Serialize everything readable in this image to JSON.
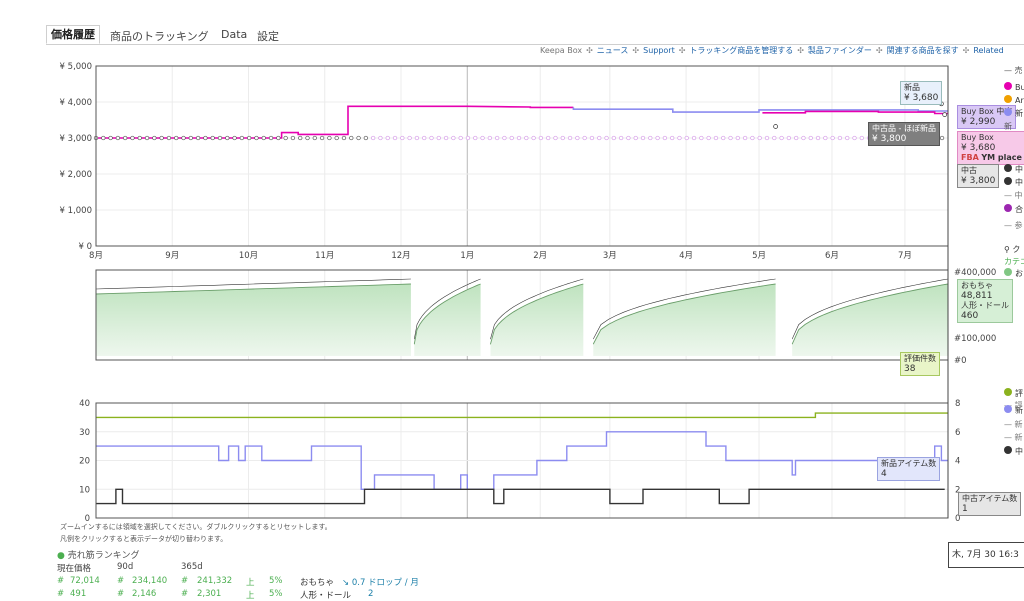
{
  "tabs": [
    "価格履歴",
    "商品のトラッキング",
    "Data",
    "設定"
  ],
  "links": [
    {
      "label": "Keepa Box",
      "gray": true
    },
    {
      "label": "ニュース"
    },
    {
      "label": "Support"
    },
    {
      "label": "トラッキング商品を管理する"
    },
    {
      "label": "製品ファインダー"
    },
    {
      "label": "関連する商品を探す"
    },
    {
      "label": "Related"
    }
  ],
  "chart_data": [
    {
      "type": "line",
      "name": "price-chart",
      "x": [
        "8月",
        "9月",
        "10月",
        "11月",
        "12月",
        "1月",
        "2月",
        "3月",
        "4月",
        "5月",
        "6月",
        "7月"
      ],
      "y_ticks": [
        "¥ 0",
        "¥ 1,000",
        "¥ 2,000",
        "¥ 3,000",
        "¥ 4,000",
        "¥ 5,000"
      ],
      "ylim": [
        0,
        5000
      ],
      "series": [
        {
          "legend_mark": "pink",
          "color": "#e600b0",
          "points": [
            [
              0,
              3000
            ],
            [
              5.6,
              3000
            ],
            [
              5.6,
              3150
            ],
            [
              6.1,
              3150
            ],
            [
              6.1,
              3100
            ],
            [
              7.6,
              3100
            ],
            [
              7.6,
              3880
            ],
            [
              11.2,
              3880
            ],
            [
              12.2,
              3870
            ],
            [
              13.1,
              3860
            ],
            [
              13.1,
              3850
            ],
            [
              14.4,
              3850
            ]
          ]
        },
        {
          "legend_mark": "blue",
          "color": "#8c8cf0",
          "points": [
            [
              14.4,
              3850
            ],
            [
              14.4,
              3800
            ],
            [
              17.4,
              3800
            ],
            [
              17.4,
              3720
            ],
            [
              20.0,
              3720
            ],
            [
              20.0,
              3780
            ],
            [
              24.8,
              3780
            ],
            [
              24.8,
              3750
            ],
            [
              25.7,
              3750
            ]
          ]
        },
        {
          "legend_mark": "pink-2",
          "color": "#e600b0",
          "points": [
            [
              20.1,
              3700
            ],
            [
              21.4,
              3700
            ],
            [
              21.4,
              3740
            ],
            [
              23.6,
              3740
            ],
            [
              23.6,
              3720
            ],
            [
              25.3,
              3720
            ],
            [
              25.3,
              3680
            ],
            [
              25.7,
              3680
            ]
          ]
        },
        {
          "legend_mark": "dots",
          "color": "#333",
          "value": 3000
        }
      ]
    },
    {
      "type": "area",
      "name": "sales-rank-chart",
      "y_ticks": [
        "#400,000",
        "#100,000",
        "#0"
      ],
      "series": [
        {
          "legend_mark": "rank",
          "color": "#4caf50"
        }
      ]
    },
    {
      "type": "line",
      "name": "count-chart",
      "y_ticks_left": [
        "0",
        "10",
        "20",
        "30",
        "40"
      ],
      "y_ticks_right": [
        "0",
        "2",
        "4",
        "6",
        "8"
      ],
      "ylim_left": [
        0,
        40
      ],
      "ylim_right": [
        0,
        8
      ],
      "series": [
        {
          "legend_mark": "review-count",
          "color": "#8bb21e",
          "axis": "right",
          "points": [
            [
              0,
              7
            ],
            [
              21.7,
              7
            ],
            [
              21.7,
              7.3
            ],
            [
              25.7,
              7.3
            ]
          ]
        },
        {
          "legend_mark": "new-offers",
          "color": "#8c8cf0",
          "axis": "right",
          "points": [
            [
              0,
              5
            ],
            [
              3.7,
              5
            ],
            [
              3.7,
              4
            ],
            [
              4.0,
              4
            ],
            [
              4.0,
              5
            ],
            [
              4.3,
              5
            ],
            [
              4.3,
              4
            ],
            [
              4.5,
              4
            ],
            [
              4.5,
              5
            ],
            [
              5.0,
              5
            ],
            [
              5.0,
              4
            ],
            [
              6.5,
              4
            ],
            [
              6.5,
              5
            ],
            [
              8.0,
              5
            ],
            [
              8.0,
              2
            ],
            [
              8.4,
              2
            ],
            [
              8.4,
              3
            ],
            [
              10.2,
              3
            ],
            [
              10.2,
              2
            ],
            [
              11.0,
              2
            ],
            [
              11.0,
              3
            ],
            [
              11.2,
              3
            ],
            [
              11.2,
              2
            ],
            [
              12.0,
              2
            ],
            [
              12.0,
              3
            ],
            [
              13.3,
              3
            ],
            [
              13.3,
              4
            ],
            [
              14.2,
              4
            ],
            [
              14.2,
              5
            ],
            [
              15.4,
              5
            ],
            [
              15.4,
              6
            ],
            [
              18.4,
              6
            ],
            [
              18.4,
              5
            ],
            [
              19.0,
              5
            ],
            [
              19.0,
              4
            ],
            [
              21.0,
              4
            ],
            [
              21.0,
              3
            ],
            [
              21.1,
              3
            ],
            [
              21.1,
              4
            ],
            [
              25.3,
              4
            ],
            [
              25.3,
              5
            ],
            [
              25.5,
              5
            ],
            [
              25.5,
              4
            ],
            [
              25.7,
              4
            ]
          ]
        },
        {
          "legend_mark": "used-offers",
          "color": "#333",
          "axis": "right",
          "points": [
            [
              0,
              1
            ],
            [
              0.6,
              1
            ],
            [
              0.6,
              2
            ],
            [
              0.8,
              2
            ],
            [
              0.8,
              1
            ],
            [
              8.1,
              1
            ],
            [
              8.1,
              2
            ],
            [
              12.0,
              2
            ],
            [
              12.0,
              1
            ],
            [
              12.3,
              1
            ],
            [
              12.3,
              2
            ],
            [
              15.5,
              2
            ],
            [
              15.5,
              1
            ],
            [
              16.5,
              1
            ],
            [
              16.5,
              2
            ],
            [
              18.8,
              2
            ],
            [
              18.8,
              1
            ],
            [
              19.7,
              1
            ],
            [
              19.7,
              2
            ],
            [
              25.6,
              2
            ]
          ]
        }
      ]
    }
  ],
  "tooltips": {
    "new_label": "新品",
    "new_value": "¥ 3,680",
    "buybox_label": "Buy Box 中古",
    "buybox_value": "¥ 2,990",
    "used_like_new_label": "中古品 - ほぼ新品",
    "used_like_new_value": "¥ 3,800",
    "buybox2_label": "Buy Box",
    "buybox2_value": "¥ 3,680",
    "buybox2_fba": "FBA",
    "buybox2_seller": "YM place",
    "used_label": "中古",
    "used_value": "¥ 3,800",
    "rank_cat": "おもちゃ",
    "rank_cat_value": "48,811",
    "rank_sub": "人形・ドール",
    "rank_sub_value": "460",
    "review_count_label": "評価件数",
    "review_count_value": "38",
    "new_item_count_label": "新品アイテム数",
    "new_item_count_value": "4",
    "used_item_count_label": "中古アイテム数",
    "used_item_count_value": "1",
    "date": "木, 7月 30 16:3"
  },
  "legend": {
    "items": [
      {
        "text": "— 売",
        "color": "#555"
      },
      {
        "text": "Bu",
        "color": "#e600b0"
      },
      {
        "text": "Ar",
        "color": "#f0a000"
      },
      {
        "text": "新",
        "color": "#8c8cf0"
      },
      {
        "text": "新",
        "color": "#555"
      },
      {
        "text": "中",
        "color": "#333"
      },
      {
        "text": "中",
        "color": "#333"
      },
      {
        "text": "— 中",
        "color": "#777"
      },
      {
        "text": "合",
        "color": "#9c27b0"
      },
      {
        "text": "— 参",
        "color": "#777"
      },
      {
        "text": "ク",
        "color": "#333"
      },
      {
        "text": "カテゴ",
        "color": "#4caf50"
      },
      {
        "text": "お",
        "color": "#4caf50"
      }
    ],
    "lower_items": [
      {
        "text": "— 評",
        "color": "#777"
      },
      {
        "text": "評",
        "color": "#8bb21e"
      },
      {
        "text": "新",
        "color": "#8c8cf0"
      },
      {
        "text": "— 新",
        "color": "#777"
      },
      {
        "text": "— 新",
        "color": "#777"
      },
      {
        "text": "中",
        "color": "#333"
      }
    ]
  },
  "info": {
    "line1": "ズームインするには領域を選択してください。ダブルクリックするとリセットします。",
    "line2": "凡例をクリックすると表示データが切り替わります。"
  },
  "ranking": {
    "title": "売れ筋ランキング",
    "headers": [
      "現在価格",
      "90d",
      "365d"
    ],
    "row1": [
      "#",
      "72,014",
      "#",
      "234,140",
      "#",
      "241,332",
      "上",
      "5%"
    ],
    "row1_cat": "おもちゃ",
    "row1_trend": "0.7 ドロップ / 月",
    "row2": [
      "#",
      "491",
      "#",
      "2,146",
      "#",
      "2,301",
      "上",
      "5%"
    ],
    "row2_cat": "人形・ドール",
    "row2_trend": "2"
  }
}
